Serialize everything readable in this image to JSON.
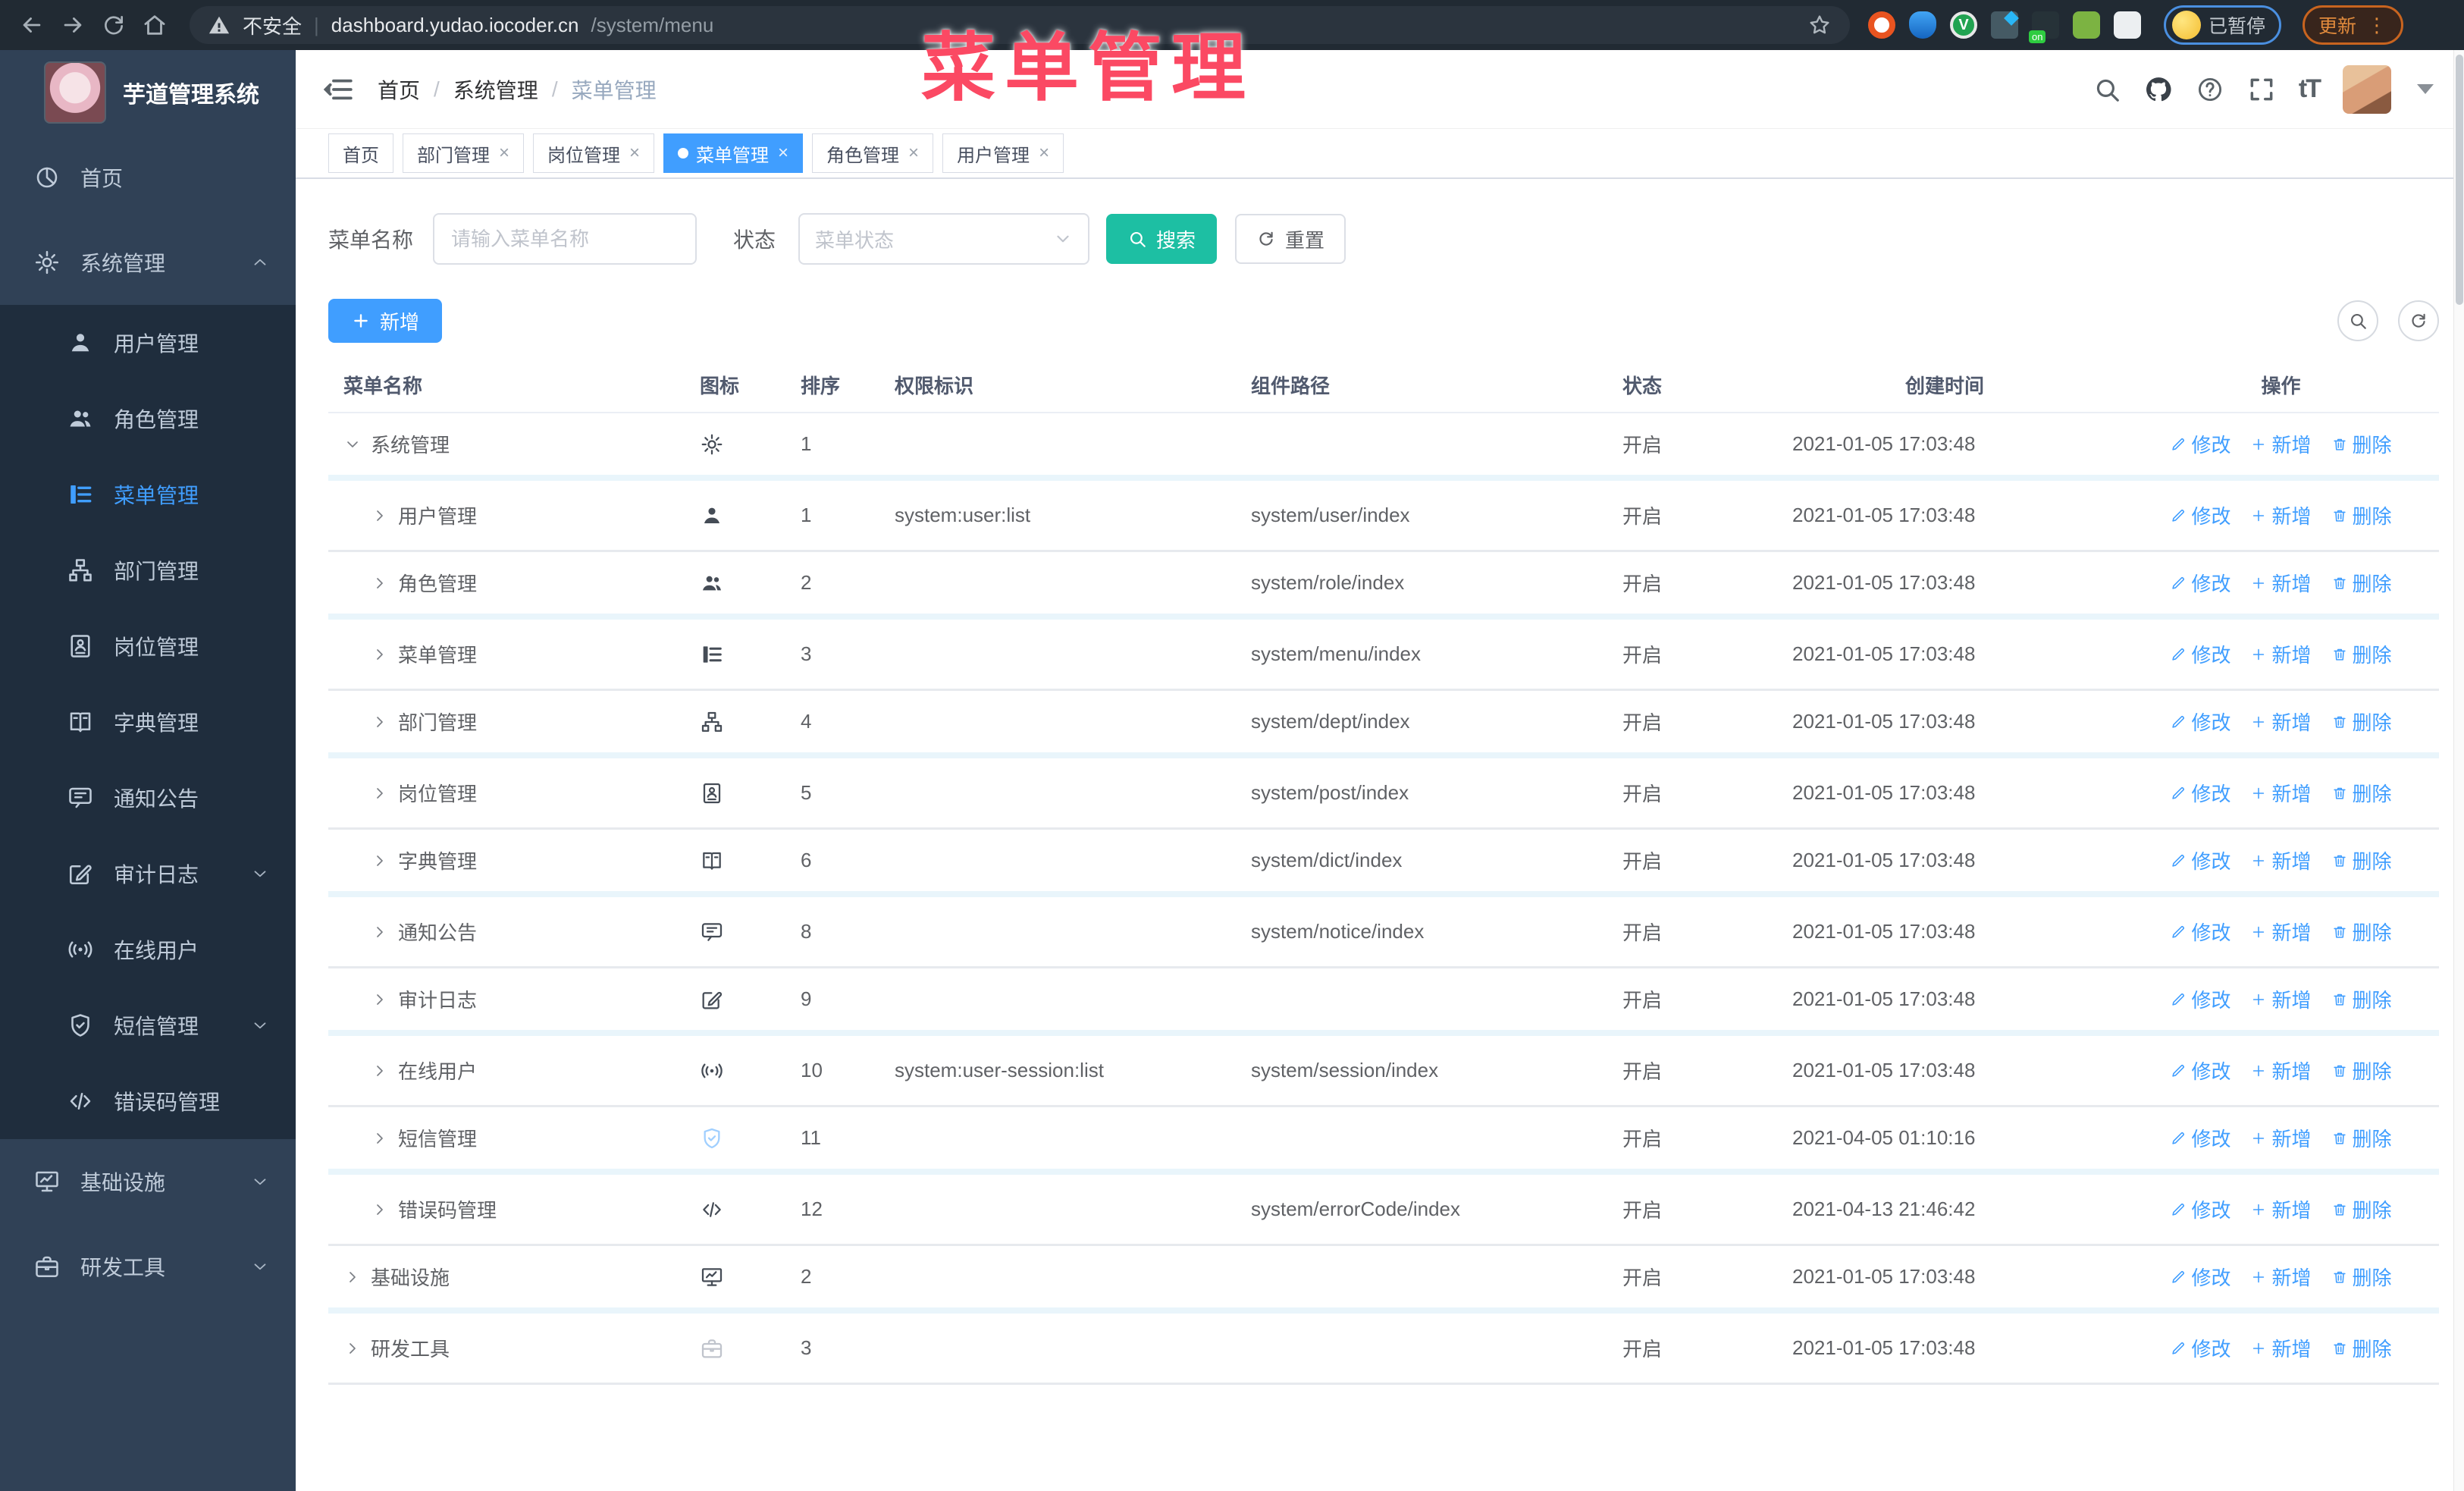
{
  "browser": {
    "security_label": "不安全",
    "url_host": "dashboard.yudao.iocoder.cn",
    "url_path": "/system/menu",
    "profile_badge": "已暂停",
    "update_button": "更新"
  },
  "watermark": "菜单管理",
  "sidebar": {
    "title": "芋道管理系统",
    "items": [
      {
        "label": "首页",
        "icon": "dashboard",
        "type": "root"
      },
      {
        "label": "系统管理",
        "icon": "gear",
        "type": "root",
        "arrow": "up"
      },
      {
        "label": "用户管理",
        "icon": "user",
        "type": "sub"
      },
      {
        "label": "角色管理",
        "icon": "users",
        "type": "sub"
      },
      {
        "label": "菜单管理",
        "icon": "tree",
        "type": "sub",
        "active": true
      },
      {
        "label": "部门管理",
        "icon": "org",
        "type": "sub"
      },
      {
        "label": "岗位管理",
        "icon": "badge",
        "type": "sub"
      },
      {
        "label": "字典管理",
        "icon": "book",
        "type": "sub"
      },
      {
        "label": "通知公告",
        "icon": "message",
        "type": "sub"
      },
      {
        "label": "审计日志",
        "icon": "edit",
        "type": "sub",
        "arrow": "down"
      },
      {
        "label": "在线用户",
        "icon": "online",
        "type": "sub"
      },
      {
        "label": "短信管理",
        "icon": "shield",
        "type": "sub",
        "arrow": "down"
      },
      {
        "label": "错误码管理",
        "icon": "code",
        "type": "sub"
      },
      {
        "label": "基础设施",
        "icon": "monitor",
        "type": "root",
        "arrow": "down"
      },
      {
        "label": "研发工具",
        "icon": "tool",
        "type": "root",
        "arrow": "down"
      }
    ]
  },
  "header": {
    "breadcrumb": [
      "首页",
      "系统管理",
      "菜单管理"
    ]
  },
  "tabs": [
    {
      "label": "首页",
      "closable": false,
      "active": false
    },
    {
      "label": "部门管理",
      "closable": true,
      "active": false
    },
    {
      "label": "岗位管理",
      "closable": true,
      "active": false
    },
    {
      "label": "菜单管理",
      "closable": true,
      "active": true
    },
    {
      "label": "角色管理",
      "closable": true,
      "active": false
    },
    {
      "label": "用户管理",
      "closable": true,
      "active": false
    }
  ],
  "filter": {
    "name_label": "菜单名称",
    "name_placeholder": "请输入菜单名称",
    "status_label": "状态",
    "status_placeholder": "菜单状态",
    "search_label": "搜索",
    "reset_label": "重置"
  },
  "toolbar": {
    "add_label": "新增"
  },
  "table": {
    "columns": [
      "菜单名称",
      "图标",
      "排序",
      "权限标识",
      "组件路径",
      "状态",
      "创建时间",
      "操作"
    ],
    "action_labels": {
      "edit": "修改",
      "add": "新增",
      "delete": "删除"
    },
    "rows": [
      {
        "name": "系统管理",
        "icon": "gear",
        "indent": 0,
        "expanded": true,
        "sort": "1",
        "perm": "",
        "path": "",
        "status": "开启",
        "time": "2021-01-05 17:03:48"
      },
      {
        "name": "用户管理",
        "icon": "user",
        "indent": 1,
        "expanded": false,
        "sort": "1",
        "perm": "system:user:list",
        "path": "system/user/index",
        "status": "开启",
        "time": "2021-01-05 17:03:48"
      },
      {
        "name": "角色管理",
        "icon": "users",
        "indent": 1,
        "expanded": false,
        "sort": "2",
        "perm": "",
        "path": "system/role/index",
        "status": "开启",
        "time": "2021-01-05 17:03:48"
      },
      {
        "name": "菜单管理",
        "icon": "tree",
        "indent": 1,
        "expanded": false,
        "sort": "3",
        "perm": "",
        "path": "system/menu/index",
        "status": "开启",
        "time": "2021-01-05 17:03:48"
      },
      {
        "name": "部门管理",
        "icon": "org",
        "indent": 1,
        "expanded": false,
        "sort": "4",
        "perm": "",
        "path": "system/dept/index",
        "status": "开启",
        "time": "2021-01-05 17:03:48"
      },
      {
        "name": "岗位管理",
        "icon": "badge",
        "indent": 1,
        "expanded": false,
        "sort": "5",
        "perm": "",
        "path": "system/post/index",
        "status": "开启",
        "time": "2021-01-05 17:03:48"
      },
      {
        "name": "字典管理",
        "icon": "book",
        "indent": 1,
        "expanded": false,
        "sort": "6",
        "perm": "",
        "path": "system/dict/index",
        "status": "开启",
        "time": "2021-01-05 17:03:48"
      },
      {
        "name": "通知公告",
        "icon": "message",
        "indent": 1,
        "expanded": false,
        "sort": "8",
        "perm": "",
        "path": "system/notice/index",
        "status": "开启",
        "time": "2021-01-05 17:03:48"
      },
      {
        "name": "审计日志",
        "icon": "edit",
        "indent": 1,
        "expanded": false,
        "sort": "9",
        "perm": "",
        "path": "",
        "status": "开启",
        "time": "2021-01-05 17:03:48"
      },
      {
        "name": "在线用户",
        "icon": "online",
        "indent": 1,
        "expanded": false,
        "sort": "10",
        "perm": "system:user-session:list",
        "path": "system/session/index",
        "status": "开启",
        "time": "2021-01-05 17:03:48"
      },
      {
        "name": "短信管理",
        "icon": "shield",
        "icon_color": "#a0cfff",
        "indent": 1,
        "expanded": false,
        "sort": "11",
        "perm": "",
        "path": "",
        "status": "开启",
        "time": "2021-04-05 01:10:16"
      },
      {
        "name": "错误码管理",
        "icon": "code",
        "indent": 1,
        "expanded": false,
        "sort": "12",
        "perm": "",
        "path": "system/errorCode/index",
        "status": "开启",
        "time": "2021-04-13 21:46:42"
      },
      {
        "name": "基础设施",
        "icon": "monitor",
        "indent": 0,
        "expanded": false,
        "sort": "2",
        "perm": "",
        "path": "",
        "status": "开启",
        "time": "2021-01-05 17:03:48"
      },
      {
        "name": "研发工具",
        "icon": "tool",
        "icon_color": "#c0c4cc",
        "indent": 0,
        "expanded": false,
        "sort": "3",
        "perm": "",
        "path": "",
        "status": "开启",
        "time": "2021-01-05 17:03:48"
      }
    ]
  },
  "colors": {
    "primary": "#409eff",
    "search_button": "#1dbfa3",
    "sidebar_bg": "#304156",
    "submenu_bg": "#1f2d3d",
    "watermark": "#fb4963"
  }
}
